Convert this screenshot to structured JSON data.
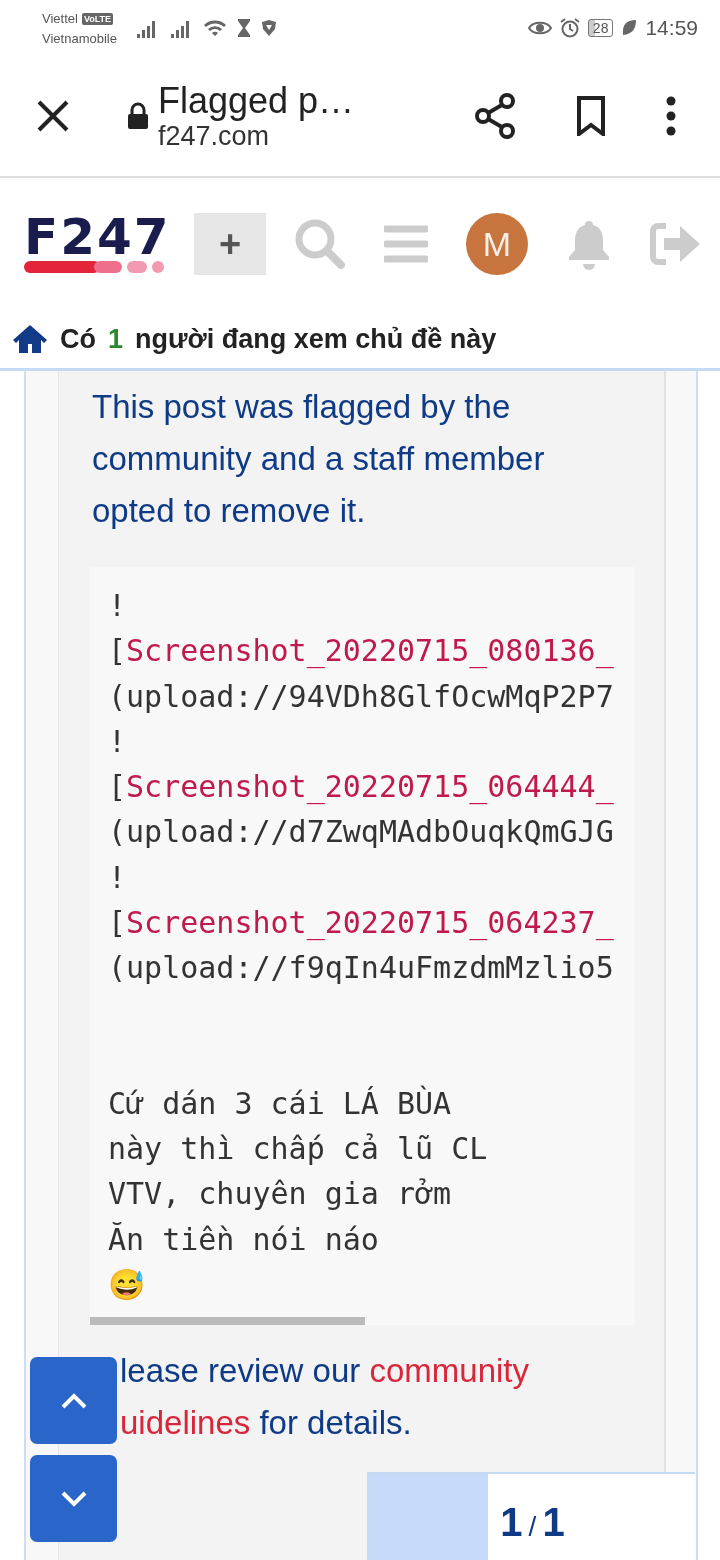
{
  "status_bar": {
    "carriers": [
      "Viettel",
      "Vietnamobile"
    ],
    "volte_badge": "VoLTE",
    "battery": "28",
    "time": "14:59"
  },
  "browser_bar": {
    "title": "Flagged p…",
    "url": "f247.com"
  },
  "site_header": {
    "logo": "F247",
    "new_button": "+",
    "avatar": "M"
  },
  "viewers_notice": {
    "prefix": "Có",
    "count": "1",
    "suffix": "người đang xem chủ đề này"
  },
  "post": {
    "flag_message": "This post was flagged by the community and a staff member opted to remove it.",
    "code_lines": [
      {
        "kind": "text",
        "text": "!"
      },
      {
        "kind": "link",
        "bracket": "[",
        "text": "Screenshot_20220715_080136_"
      },
      {
        "kind": "text",
        "text": "(upload://94VDh8GlfOcwMqP2P7"
      },
      {
        "kind": "text",
        "text": "!"
      },
      {
        "kind": "link",
        "bracket": "[",
        "text": "Screenshot_20220715_064444_"
      },
      {
        "kind": "text",
        "text": "(upload://d7ZwqMAdbOuqkQmGJG"
      },
      {
        "kind": "text",
        "text": "!"
      },
      {
        "kind": "link",
        "bracket": "[",
        "text": "Screenshot_20220715_064237_"
      },
      {
        "kind": "text",
        "text": "(upload://f9qIn4uFmzdmMzlio5"
      }
    ],
    "message_lines": [
      "Cứ dán 3 cái LÁ BÙA",
      "này thì chấp cả lũ CL",
      "VTV, chuyên gia rởm",
      "Ăn tiền nói náo",
      "😅"
    ],
    "review_note": {
      "line_1": "lease review our",
      "link_1": "community",
      "link_2": "uidelines",
      "line_2": "for details."
    }
  },
  "progress": {
    "level": 0.37,
    "current": "1",
    "separator": "/",
    "total": "1"
  }
}
